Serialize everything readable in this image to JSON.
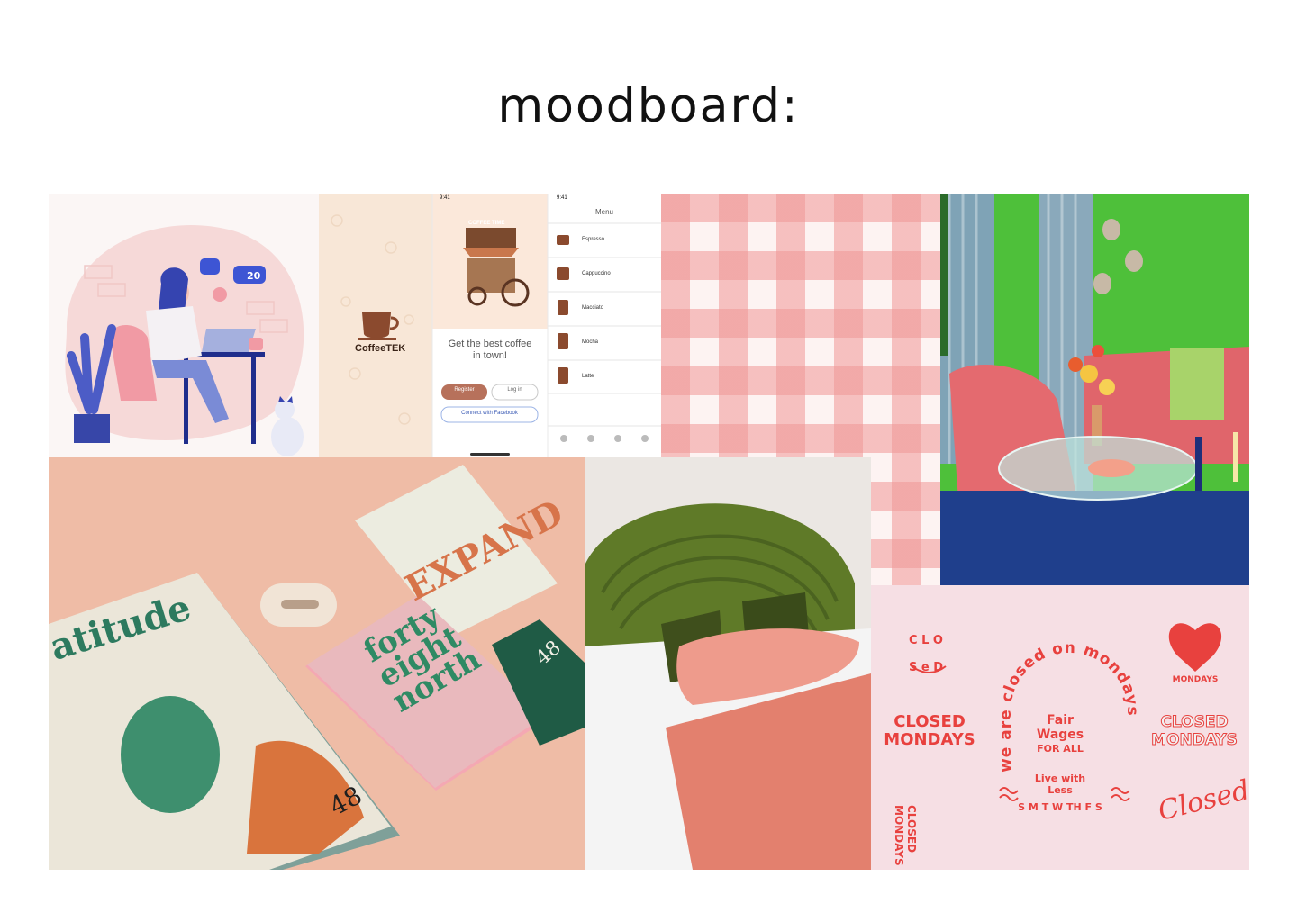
{
  "title": "moodboard:",
  "tiles": {
    "illustration": {
      "like_count": "20"
    },
    "coffee_app": {
      "brand": "CoffeeTEK",
      "status_time": "9:41",
      "cart_sign": "COFFEE TIME",
      "headline_line1": "Get the best coffee",
      "headline_line2": "in town!",
      "register": "Register",
      "login": "Log in",
      "facebook": "Connect with Facebook",
      "menu_title": "Menu",
      "menu_items": [
        "Espresso",
        "Cappuccino",
        "Macciato",
        "Mocha",
        "Latte"
      ]
    },
    "stationery": {
      "magazine": "atitude",
      "notebook_line1": "forty",
      "notebook_line2": "eight",
      "notebook_line3": "north",
      "expand": "EXPAND",
      "badge": "48"
    },
    "closed_mondays": {
      "arch_text": "we are closed on mondays",
      "fair_line1": "Fair",
      "fair_line2": "Wages",
      "fair_line3": "FOR ALL",
      "live_with_less": "Live with Less",
      "days": "S M T W TH F S",
      "closed_line1": "CLOSED",
      "closed_line2": "MONDAYS",
      "closed_script": "Closed",
      "vertical_closed": "CLOSED",
      "vertical_mondays": "MONDAYS",
      "heart_mondays": "MONDAYS",
      "clo": "C L O",
      "sed": "S e D"
    }
  }
}
